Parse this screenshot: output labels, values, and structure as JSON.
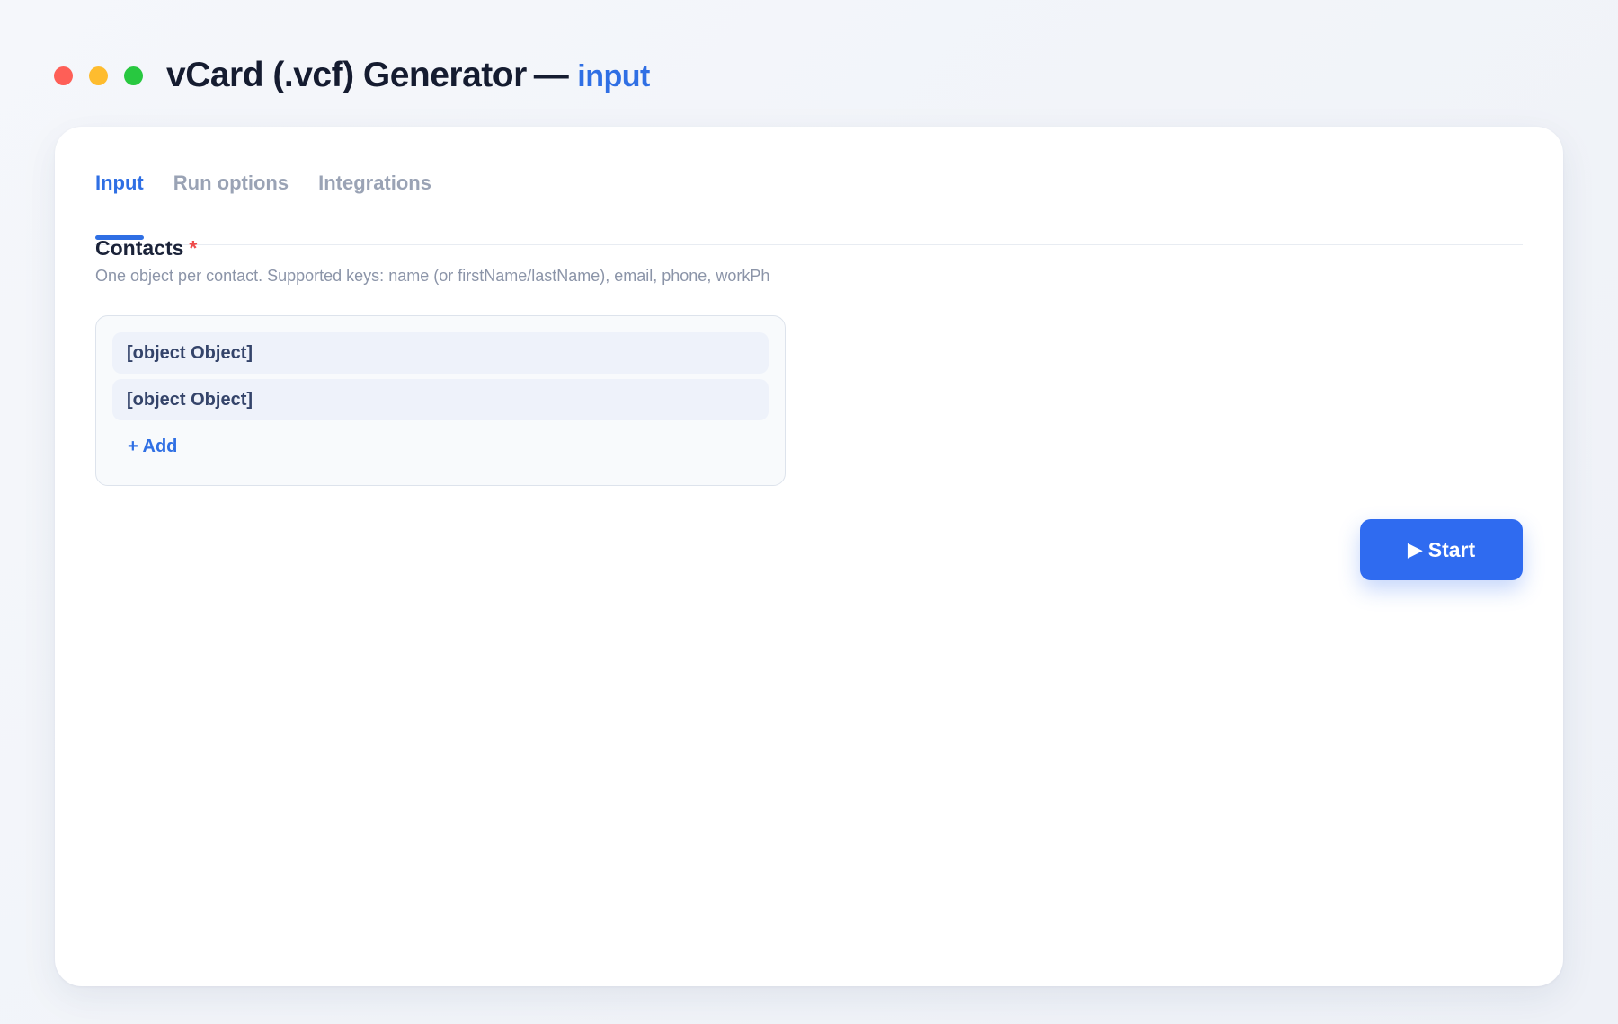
{
  "window": {
    "controls": [
      {
        "name": "close",
        "color": "#fe5f57"
      },
      {
        "name": "minimize",
        "color": "#febc2e"
      },
      {
        "name": "maximize",
        "color": "#28c840"
      }
    ],
    "title": "vCard (.vcf) Generator",
    "separator": "—",
    "mode": "input"
  },
  "tabs": [
    {
      "label": "Input",
      "active": true
    },
    {
      "label": "Run options",
      "active": false
    },
    {
      "label": "Integrations",
      "active": false
    }
  ],
  "contacts_field": {
    "label": "Contacts",
    "required_marker": "*",
    "description": "One object per contact. Supported keys: name (or firstName/lastName), email, phone, workPh",
    "items": [
      "[object Object]",
      "[object Object]"
    ],
    "add_label": "+ Add"
  },
  "actions": {
    "start_icon": "▶",
    "start_label": "Start"
  },
  "colors": {
    "accent": "#2f6fe4",
    "required": "#ef4b4b"
  }
}
